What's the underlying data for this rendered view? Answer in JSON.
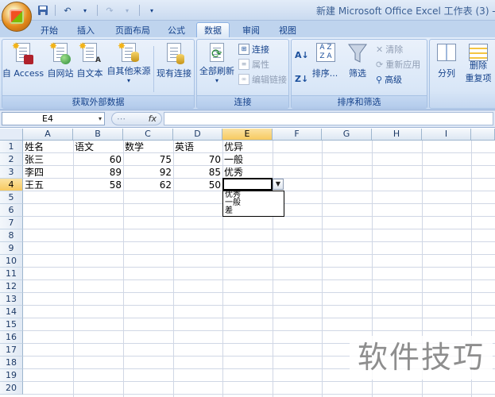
{
  "window": {
    "title": "新建 Microsoft Office Excel 工作表 (3) -"
  },
  "qat": {
    "save_icon": "save-icon",
    "undo_icon": "undo-icon",
    "redo_icon": "redo-icon"
  },
  "tabs": [
    {
      "label": "开始"
    },
    {
      "label": "插入"
    },
    {
      "label": "页面布局"
    },
    {
      "label": "公式"
    },
    {
      "label": "数据"
    },
    {
      "label": "审阅"
    },
    {
      "label": "视图"
    }
  ],
  "ribbon": {
    "external": {
      "group_label": "获取外部数据",
      "access": "自 Access",
      "web": "自网站",
      "text": "自文本",
      "other": "自其他来源",
      "existing": "现有连接"
    },
    "connections": {
      "group_label": "连接",
      "refresh": "全部刷新",
      "connections": "连接",
      "properties": "属性",
      "edit_links": "编辑链接"
    },
    "sort_filter": {
      "group_label": "排序和筛选",
      "sort": "排序...",
      "filter": "筛选",
      "clear": "清除",
      "reapply": "重新应用",
      "advanced": "高级"
    },
    "tools": {
      "split": "分列",
      "remove": "删除",
      "remove2": "重复项"
    }
  },
  "formula_bar": {
    "name_box": "E4",
    "fx": "fx",
    "value": ""
  },
  "sheet": {
    "columns": [
      "A",
      "B",
      "C",
      "D",
      "E",
      "F",
      "G",
      "H",
      "I"
    ],
    "rows": [
      "1",
      "2",
      "3",
      "4",
      "5",
      "6",
      "7",
      "8",
      "9",
      "10",
      "11",
      "12",
      "13",
      "14",
      "15",
      "16",
      "17",
      "18",
      "19",
      "20"
    ],
    "cells": {
      "r1": [
        "姓名",
        "语文",
        "数学",
        "英语",
        "优异"
      ],
      "r2": [
        "张三",
        "60",
        "75",
        "70",
        "一般"
      ],
      "r3": [
        "李四",
        "89",
        "92",
        "85",
        "优秀"
      ],
      "r4": [
        "王五",
        "58",
        "62",
        "50",
        ""
      ]
    },
    "dropdown_options": [
      "优秀",
      "一般",
      "差"
    ]
  },
  "watermark": "软件技巧"
}
